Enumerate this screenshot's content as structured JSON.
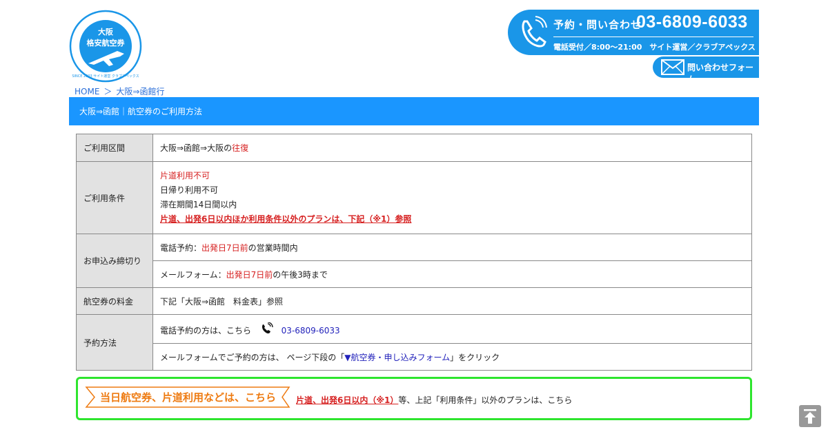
{
  "header": {
    "logo": {
      "city": "大阪",
      "title": "格安航空券",
      "ring_text": "SINCE 2003 サイト運営 クラブアペックス"
    },
    "contact": {
      "label": "予約・問い合わせ",
      "phone": "03-6809-6033",
      "hours": "電話受付／8:00～21:00　サイト運営／クラブアペックス"
    },
    "form_button": "問い合わせフォーム"
  },
  "breadcrumb": {
    "home": "HOME",
    "separator": "＞",
    "current": "大阪⇒函館行"
  },
  "title_bar": "大阪⇒函館｜航空券のご利用方法",
  "table": {
    "route": {
      "header": "ご利用区間",
      "value_prefix": "大阪⇒函館⇒大阪の",
      "value_highlight": "往復"
    },
    "conditions": {
      "header": "ご利用条件",
      "line1": "片道利用不可",
      "line2": "日帰り利用不可",
      "line3": "滞在期間14日間以内",
      "line4": "片道、出発6日以内ほか利用条件以外のプランは、下記（※1）参照"
    },
    "deadline": {
      "header": "お申込み締切り",
      "phone_prefix": "電話予約：",
      "phone_highlight": "出発日7日前",
      "phone_suffix": "の営業時間内",
      "mail_prefix": "メールフォーム：",
      "mail_highlight": "出発日7日前",
      "mail_suffix": "の午後3時まで"
    },
    "fare": {
      "header": "航空券の料金",
      "value": "下記「大阪⇒函館　料金表」参照"
    },
    "method": {
      "header": "予約方法",
      "phone_text": "電話予約の方は、こちら",
      "phone_number": "03-6809-6033",
      "mail_prefix": "メールフォームでご予約の方は、 ページ下段の「",
      "mail_link": "▼航空券・申し込みフォーム",
      "mail_suffix": "」をクリック"
    }
  },
  "green_box": {
    "banner": "当日航空券、片道利用などは、こちら",
    "note_highlight": "片道、出発6日以内（※1）",
    "note_suffix": "等、上記「利用条件」以外のプランは、こちら"
  },
  "colors": {
    "brand_blue": "#1a96e8",
    "title_bar_blue": "#1a96ff",
    "accent_red": "#d62020",
    "green_border": "#2ee52e",
    "banner_orange": "#ee7a10"
  }
}
